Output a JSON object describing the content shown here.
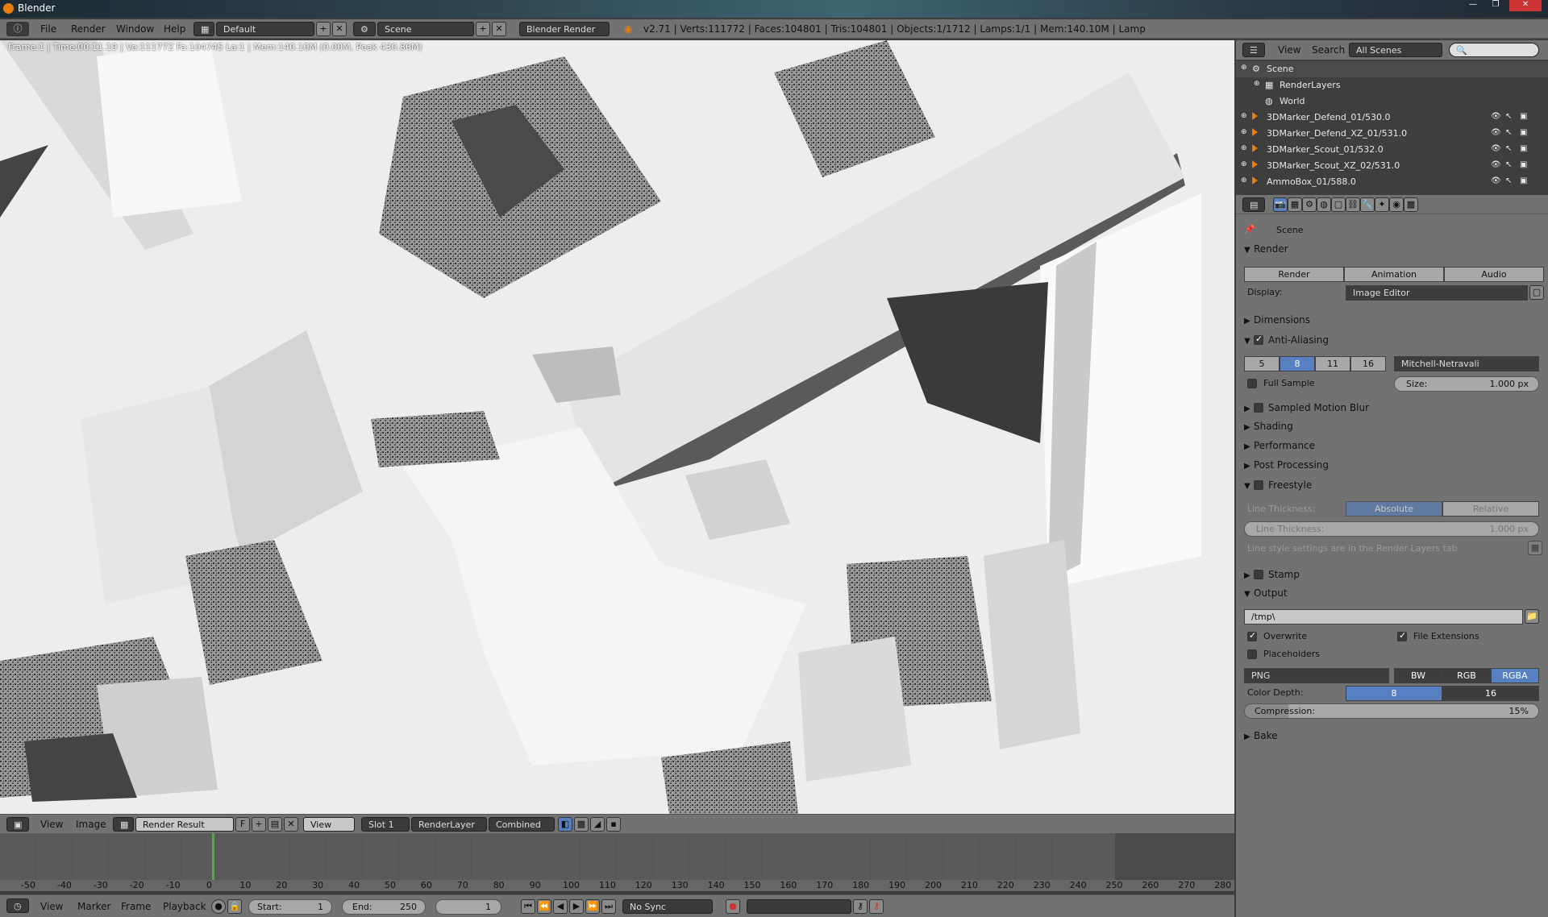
{
  "window": {
    "title": "Blender"
  },
  "info_header": {
    "menus": [
      "File",
      "Render",
      "Window",
      "Help"
    ],
    "layout": "Default",
    "scene": "Scene",
    "engine": "Blender Render",
    "stats": "v2.71 | Verts:111772 | Faces:104801 | Tris:104801 | Objects:1/1712 | Lamps:1/1 | Mem:140.10M | Lamp"
  },
  "viewport": {
    "info": "Frame:1 | Time:00:11.19 | Ve:111772 Fa:104745 La:1 | Mem:140.10M (0.00M, Peak 430.86M)"
  },
  "image_header": {
    "view": "View",
    "image": "Image",
    "image_name": "Render Result",
    "f_label": "F",
    "view_dd": "View",
    "slot": "Slot 1",
    "layer": "RenderLayer",
    "pass": "Combined"
  },
  "timeline": {
    "ticks": [
      "-50",
      "-40",
      "-30",
      "-20",
      "-10",
      "0",
      "10",
      "20",
      "30",
      "40",
      "50",
      "60",
      "70",
      "80",
      "90",
      "100",
      "110",
      "120",
      "130",
      "140",
      "150",
      "160",
      "170",
      "180",
      "190",
      "200",
      "210",
      "220",
      "230",
      "240",
      "250",
      "260",
      "270",
      "280"
    ],
    "current_frame": 1,
    "view": "View",
    "marker": "Marker",
    "frame": "Frame",
    "playback": "Playback",
    "start_label": "Start:",
    "start": "1",
    "end_label": "End:",
    "end": "250",
    "current": "1",
    "sync": "No Sync"
  },
  "outliner": {
    "view": "View",
    "search": "Search",
    "scenes": "All Scenes",
    "items": [
      {
        "label": "Scene"
      },
      {
        "label": "RenderLayers"
      },
      {
        "label": "World"
      },
      {
        "label": "3DMarker_Defend_01/530.0"
      },
      {
        "label": "3DMarker_Defend_XZ_01/531.0"
      },
      {
        "label": "3DMarker_Scout_01/532.0"
      },
      {
        "label": "3DMarker_Scout_XZ_02/531.0"
      },
      {
        "label": "AmmoBox_01/588.0"
      }
    ]
  },
  "properties": {
    "context": "Scene",
    "render": {
      "title": "Render",
      "render_btn": "Render",
      "animation_btn": "Animation",
      "audio_btn": "Audio",
      "display_label": "Display:",
      "display_value": "Image Editor"
    },
    "dimensions": "Dimensions",
    "aa": {
      "title": "Anti-Aliasing",
      "samples": [
        "5",
        "8",
        "11",
        "16"
      ],
      "filter": "Mitchell-Netravali",
      "full_sample": "Full Sample",
      "size": "Size:",
      "size_value": "1.000 px"
    },
    "motion_blur": "Sampled Motion Blur",
    "shading": "Shading",
    "performance": "Performance",
    "post": "Post Processing",
    "freestyle": {
      "title": "Freestyle",
      "lt_label": "Line Thickness:",
      "absolute": "Absolute",
      "relative": "Relative",
      "lt_field": "Line Thickness:",
      "lt_value": "1.000 px",
      "note": "Line style settings are in the Render Layers tab"
    },
    "stamp": "Stamp",
    "output": {
      "title": "Output",
      "path": "/tmp\\",
      "overwrite": "Overwrite",
      "file_ext": "File Extensions",
      "placeholders": "Placeholders",
      "format": "PNG",
      "bw": "BW",
      "rgb": "RGB",
      "rgba": "RGBA",
      "depth_label": "Color Depth:",
      "depth8": "8",
      "depth16": "16",
      "compression_label": "Compression:",
      "compression": "15%"
    },
    "bake": "Bake"
  },
  "colors": {
    "accent": "#5680c2",
    "header": "#727272",
    "panel": "#3d3d3d",
    "cursor": "#4caf3c"
  }
}
